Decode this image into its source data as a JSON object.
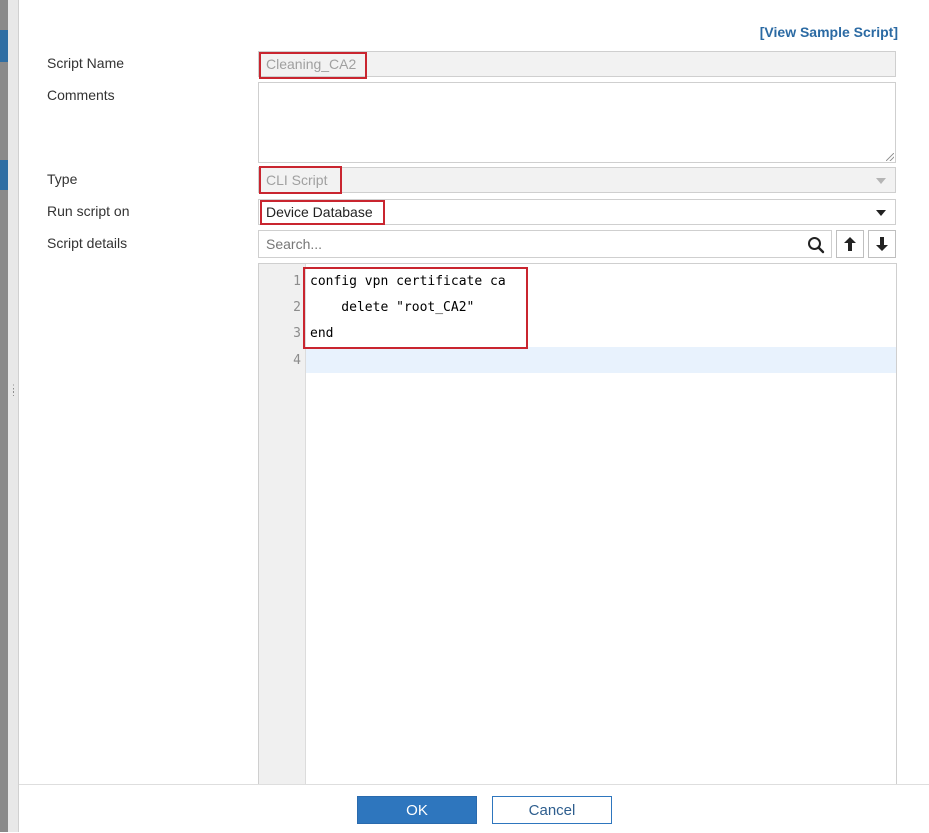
{
  "header": {
    "view_sample_label": "[View Sample Script]"
  },
  "form": {
    "script_name": {
      "label": "Script Name",
      "value": "Cleaning_CA2"
    },
    "comments": {
      "label": "Comments",
      "value": ""
    },
    "type": {
      "label": "Type",
      "value": "CLI Script"
    },
    "run_on": {
      "label": "Run script on",
      "value": "Device Database"
    },
    "details": {
      "label": "Script details",
      "search_placeholder": "Search..."
    }
  },
  "editor": {
    "lines": [
      {
        "number": "1",
        "text": "config vpn certificate ca"
      },
      {
        "number": "2",
        "text": "    delete \"root_CA2\""
      },
      {
        "number": "3",
        "text": "end"
      },
      {
        "number": "4",
        "text": ""
      }
    ]
  },
  "footer": {
    "ok_label": "OK",
    "cancel_label": "Cancel"
  },
  "colors": {
    "accent": "#2e76be",
    "highlight_border": "#c9252f",
    "link": "#2b6aa3"
  }
}
